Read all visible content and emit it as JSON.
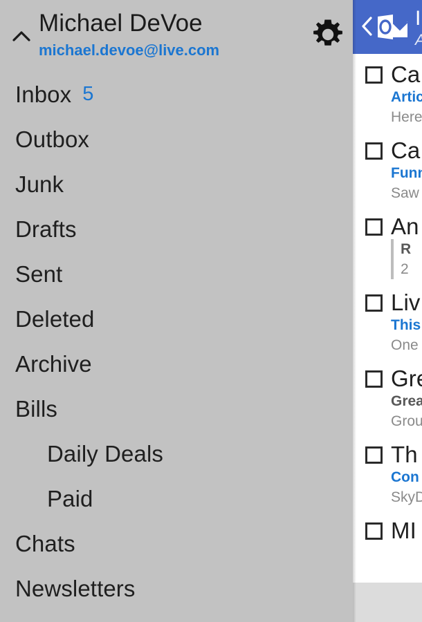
{
  "account": {
    "name": "Michael DeVoe",
    "email": "michael.devoe@live.com",
    "collapse_icon": "chevron-up-icon",
    "settings_icon": "gear-icon"
  },
  "sidebar": {
    "folders": [
      {
        "label": "Inbox",
        "count": "5",
        "nested": false
      },
      {
        "label": "Outbox",
        "count": "",
        "nested": false
      },
      {
        "label": "Junk",
        "count": "",
        "nested": false
      },
      {
        "label": "Drafts",
        "count": "",
        "nested": false
      },
      {
        "label": "Sent",
        "count": "",
        "nested": false
      },
      {
        "label": "Deleted",
        "count": "",
        "nested": false
      },
      {
        "label": "Archive",
        "count": "",
        "nested": false
      },
      {
        "label": "Bills",
        "count": "",
        "nested": false
      },
      {
        "label": "Daily Deals",
        "count": "",
        "nested": true
      },
      {
        "label": "Paid",
        "count": "",
        "nested": true
      },
      {
        "label": "Chats",
        "count": "",
        "nested": false
      },
      {
        "label": "Newsletters",
        "count": "",
        "nested": false
      }
    ]
  },
  "message_pane": {
    "header": {
      "back_icon": "back-chevron-icon",
      "logo_icon": "outlook-logo-icon",
      "title": "I",
      "subtitle": "A",
      "background_color": "#4568c8"
    },
    "messages": [
      {
        "sender": "Ca",
        "subject": "Artic",
        "preview": "Here",
        "state": "unread",
        "threaded": false
      },
      {
        "sender": "Ca",
        "subject": "Funn",
        "preview": "Saw",
        "state": "unread",
        "threaded": false
      },
      {
        "sender": "An",
        "subject": "R",
        "preview": "2",
        "state": "read",
        "threaded": true
      },
      {
        "sender": "Liv",
        "subject": "This",
        "preview": "One",
        "state": "unread",
        "threaded": false
      },
      {
        "sender": "Gre",
        "subject": "Grea",
        "preview": "Grou",
        "state": "read",
        "threaded": false
      },
      {
        "sender": "Th",
        "subject": "Con",
        "preview": "SkyD",
        "state": "unread",
        "threaded": false
      },
      {
        "sender": "MI",
        "subject": "",
        "preview": "",
        "state": "unread",
        "threaded": false
      }
    ]
  },
  "colors": {
    "sidebar_bg": "#c2c2c2",
    "accent_blue": "#1b76d1",
    "header_blue": "#4568c8",
    "footer_gray": "#dcdcdc"
  }
}
